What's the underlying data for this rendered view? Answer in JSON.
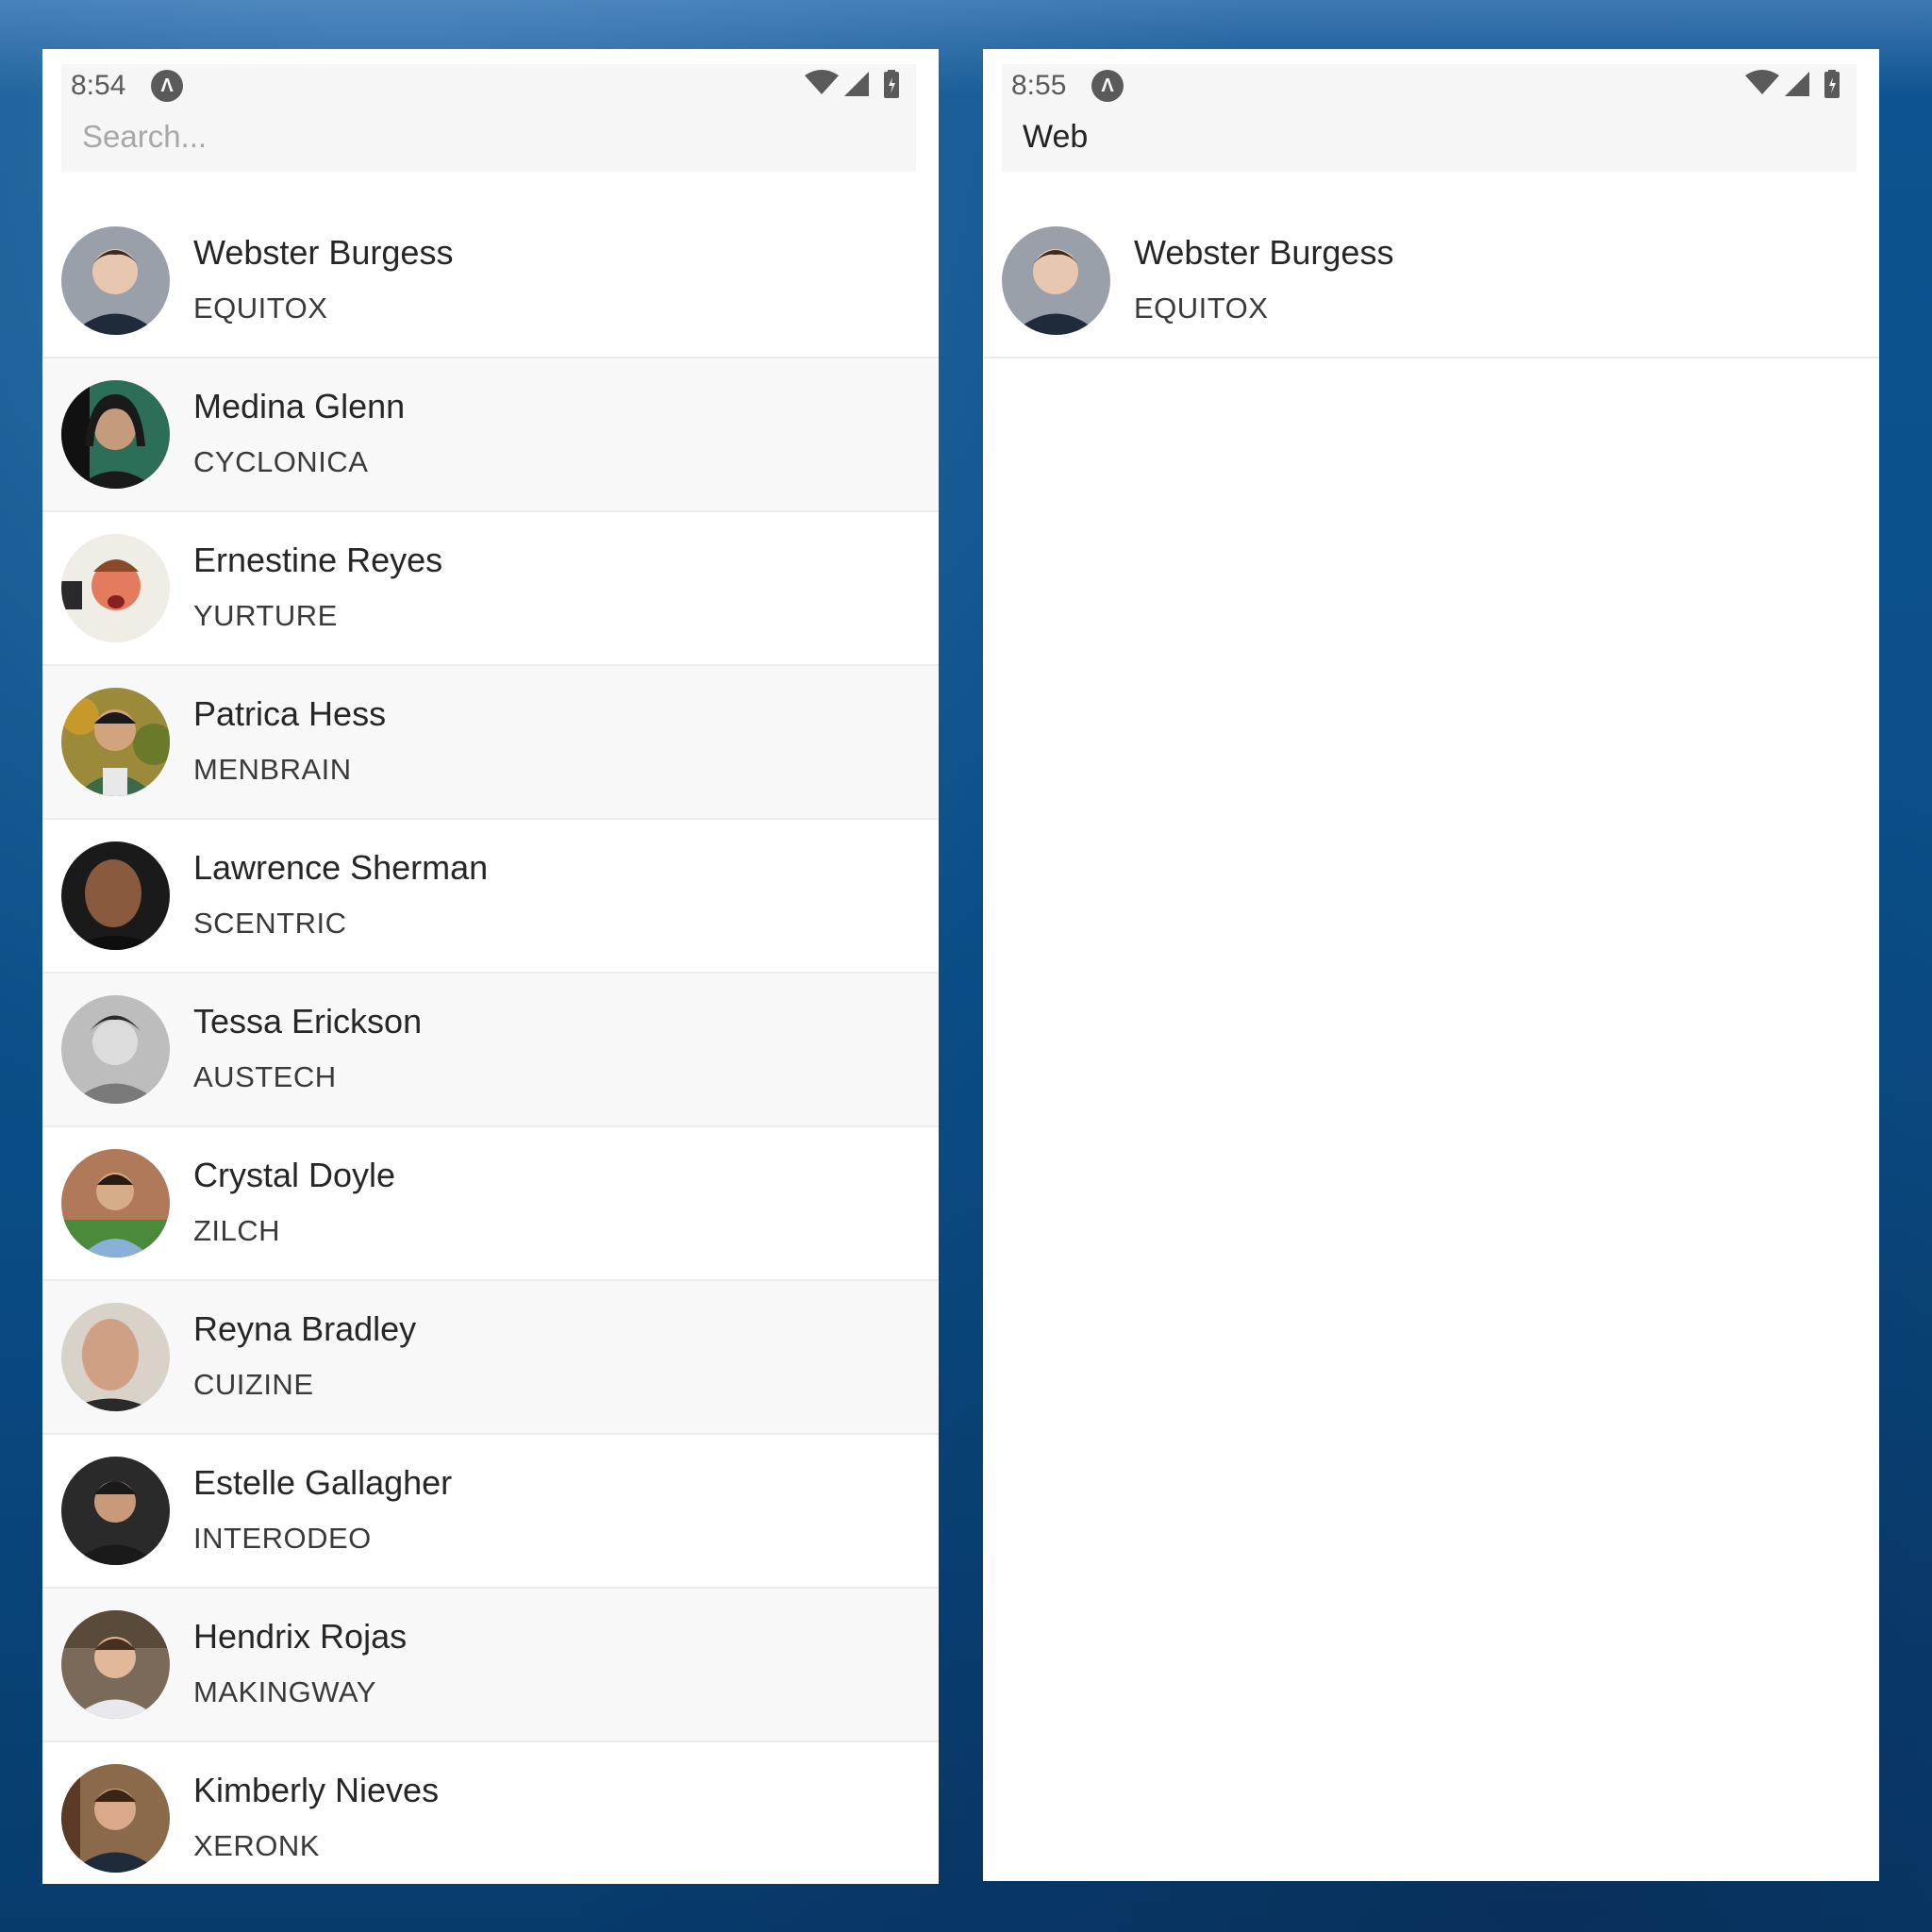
{
  "left_phone": {
    "status": {
      "time": "8:54",
      "icons": [
        "a-notification-icon",
        "wifi-icon",
        "signal-icon",
        "battery-icon"
      ]
    },
    "search": {
      "placeholder": "Search..."
    },
    "contacts": [
      {
        "name": "Webster Burgess",
        "company": "EQUITOX",
        "avatar_color": "#8a8f99"
      },
      {
        "name": "Medina Glenn",
        "company": "CYCLONICA",
        "avatar_color": "#2c6e58"
      },
      {
        "name": "Ernestine Reyes",
        "company": "YURTURE",
        "avatar_color": "#d88b6d"
      },
      {
        "name": "Patrica Hess",
        "company": "MENBRAIN",
        "avatar_color": "#8a7a3a"
      },
      {
        "name": "Lawrence Sherman",
        "company": "SCENTRIC",
        "avatar_color": "#3a2a22"
      },
      {
        "name": "Tessa Erickson",
        "company": "AUSTECH",
        "avatar_color": "#a9a9a9"
      },
      {
        "name": "Crystal Doyle",
        "company": "ZILCH",
        "avatar_color": "#7e6a57"
      },
      {
        "name": "Reyna Bradley",
        "company": "CUIZINE",
        "avatar_color": "#b08b76"
      },
      {
        "name": "Estelle Gallagher",
        "company": "INTERODEO",
        "avatar_color": "#2a2a2a"
      },
      {
        "name": "Hendrix Rojas",
        "company": "MAKINGWAY",
        "avatar_color": "#6a5a4a"
      },
      {
        "name": "Kimberly Nieves",
        "company": "XERONK",
        "avatar_color": "#7a5a3c"
      }
    ]
  },
  "right_phone": {
    "status": {
      "time": "8:55",
      "icons": [
        "a-notification-icon",
        "wifi-icon",
        "signal-icon",
        "battery-icon"
      ]
    },
    "search": {
      "value": "Web"
    },
    "contacts": [
      {
        "name": "Webster Burgess",
        "company": "EQUITOX",
        "avatar_color": "#8a8f99"
      }
    ]
  }
}
